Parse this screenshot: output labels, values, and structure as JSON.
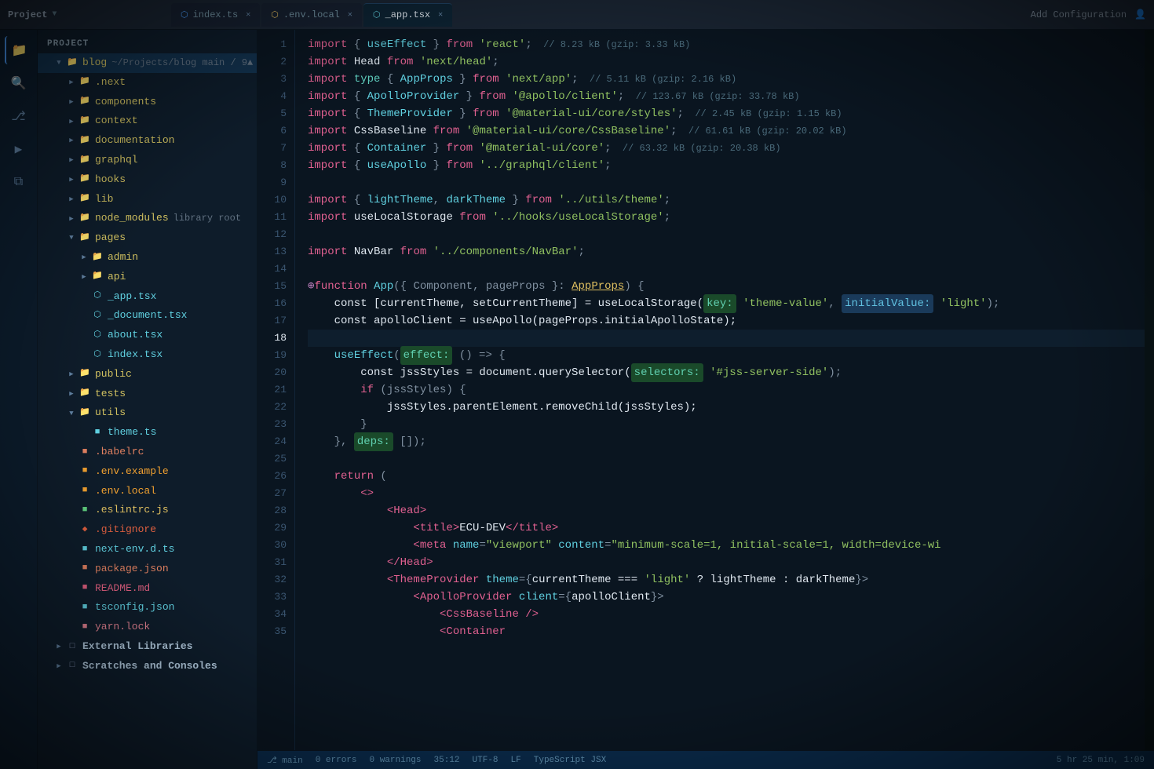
{
  "title_bar": {
    "project_label": "Project",
    "chevron": "▼",
    "tabs": [
      {
        "name": "index.ts",
        "icon": "⬡",
        "type": "ts",
        "active": false
      },
      {
        "name": ".env.local",
        "icon": "⬡",
        "type": "env",
        "active": false
      },
      {
        "name": "_app.tsx",
        "icon": "⬡",
        "type": "tsx",
        "active": true
      }
    ],
    "add_config": "Add Configuration",
    "run_button": "▶"
  },
  "sidebar": {
    "header": "Project",
    "tree": [
      {
        "id": "blog",
        "level": 1,
        "type": "folder-open",
        "label": "blog",
        "sublabel": "~/Projects/blog main / 9▲",
        "arrow": "▼"
      },
      {
        "id": "next",
        "level": 2,
        "type": "folder",
        "label": ".next",
        "arrow": "▶"
      },
      {
        "id": "components",
        "level": 2,
        "type": "folder",
        "label": "components",
        "arrow": "▶"
      },
      {
        "id": "context",
        "level": 2,
        "type": "folder",
        "label": "context",
        "arrow": "▶"
      },
      {
        "id": "documentation",
        "level": 2,
        "type": "folder",
        "label": "documentation",
        "arrow": "▶"
      },
      {
        "id": "graphql",
        "level": 2,
        "type": "folder",
        "label": "graphql",
        "arrow": "▶"
      },
      {
        "id": "hooks",
        "level": 2,
        "type": "folder",
        "label": "hooks",
        "arrow": "▶"
      },
      {
        "id": "lib",
        "level": 2,
        "type": "folder",
        "label": "lib",
        "arrow": "▶"
      },
      {
        "id": "node_modules",
        "level": 2,
        "type": "folder",
        "label": "node_modules",
        "sublabel": "library root",
        "arrow": "▶"
      },
      {
        "id": "pages",
        "level": 2,
        "type": "folder-open",
        "label": "pages",
        "arrow": "▼"
      },
      {
        "id": "admin",
        "level": 3,
        "type": "folder",
        "label": "admin",
        "arrow": "▶"
      },
      {
        "id": "api",
        "level": 3,
        "type": "folder",
        "label": "api",
        "arrow": "▶"
      },
      {
        "id": "_app_tsx",
        "level": 3,
        "type": "file-tsx",
        "label": "_app.tsx"
      },
      {
        "id": "_document_tsx",
        "level": 3,
        "type": "file-tsx",
        "label": "_document.tsx"
      },
      {
        "id": "about_tsx",
        "level": 3,
        "type": "file-tsx",
        "label": "about.tsx"
      },
      {
        "id": "index_tsx",
        "level": 3,
        "type": "file-tsx",
        "label": "index.tsx"
      },
      {
        "id": "public",
        "level": 2,
        "type": "folder",
        "label": "public",
        "arrow": "▶"
      },
      {
        "id": "tests",
        "level": 2,
        "type": "folder",
        "label": "tests",
        "arrow": "▶"
      },
      {
        "id": "utils",
        "level": 2,
        "type": "folder-open",
        "label": "utils",
        "arrow": "▼"
      },
      {
        "id": "theme_ts",
        "level": 3,
        "type": "file-ts",
        "label": "theme.ts"
      },
      {
        "id": "babelrc",
        "level": 2,
        "type": "file-json",
        "label": ".babelrc"
      },
      {
        "id": "env_example",
        "level": 2,
        "type": "file-env",
        "label": ".env.example"
      },
      {
        "id": "env_local",
        "level": 2,
        "type": "file-env",
        "label": ".env.local"
      },
      {
        "id": "eslintrc",
        "level": 2,
        "type": "file-js",
        "label": ".eslintrc.js"
      },
      {
        "id": "gitignore",
        "level": 2,
        "type": "file-git",
        "label": ".gitignore"
      },
      {
        "id": "next_env",
        "level": 2,
        "type": "file-ts",
        "label": "next-env.d.ts"
      },
      {
        "id": "package_json",
        "level": 2,
        "type": "file-json",
        "label": "package.json"
      },
      {
        "id": "readme",
        "level": 2,
        "type": "file-md",
        "label": "README.md"
      },
      {
        "id": "tsconfig",
        "level": 2,
        "type": "file-json",
        "label": "tsconfig.json"
      },
      {
        "id": "yarn_lock",
        "level": 2,
        "type": "file-lock",
        "label": "yarn.lock"
      },
      {
        "id": "external_libs",
        "level": 1,
        "type": "folder",
        "label": "External Libraries",
        "arrow": "▶"
      },
      {
        "id": "scratches",
        "level": 1,
        "type": "folder",
        "label": "Scratches and Consoles",
        "arrow": "▶"
      }
    ]
  },
  "code": {
    "filename": "_app.tsx",
    "lines": [
      {
        "n": 1,
        "content": "import { useEffect } from 'react'; // 8.23 kB (gzip: 3.33 kB)"
      },
      {
        "n": 2,
        "content": "import Head from 'next/head';"
      },
      {
        "n": 3,
        "content": "import type { AppProps } from 'next/app'; // 5.11 kB (gzip: 2.16 kB)"
      },
      {
        "n": 4,
        "content": "import { ApolloProvider } from '@apollo/client'; // 123.67 kB (gzip: 33.78 kB)"
      },
      {
        "n": 5,
        "content": "import { ThemeProvider } from '@material-ui/core/styles'; // 2.45 kB (gzip: 1.15 kB)"
      },
      {
        "n": 6,
        "content": "import CssBaseline from '@material-ui/core/CssBaseline'; // 61.61 kB (gzip: 20.02 kB)"
      },
      {
        "n": 7,
        "content": "import { Container } from '@material-ui/core'; // 63.32 kB (gzip: 20.38 kB)"
      },
      {
        "n": 8,
        "content": "import { useApollo } from '../graphql/client';"
      },
      {
        "n": 9,
        "content": ""
      },
      {
        "n": 10,
        "content": "import { lightTheme, darkTheme } from '../utils/theme';"
      },
      {
        "n": 11,
        "content": "import useLocalStorage from '../hooks/useLocalStorage';"
      },
      {
        "n": 12,
        "content": ""
      },
      {
        "n": 13,
        "content": "import NavBar from '../components/NavBar';"
      },
      {
        "n": 14,
        "content": ""
      },
      {
        "n": 15,
        "content": "function App({ Component, pageProps }: AppProps) {"
      },
      {
        "n": 16,
        "content": "  const [currentTheme, setCurrentTheme] = useLocalStorage( key: 'theme-value',  initialValue: 'light');"
      },
      {
        "n": 17,
        "content": "  const apolloClient = useApollo(pageProps.initialApolloState);"
      },
      {
        "n": 18,
        "content": ""
      },
      {
        "n": 19,
        "content": "  useEffect( effect: () => {"
      },
      {
        "n": 20,
        "content": "    const jssStyles = document.querySelector( selectors: '#jss-server-side');"
      },
      {
        "n": 21,
        "content": "    if (jssStyles) {"
      },
      {
        "n": 22,
        "content": "      jssStyles.parentElement.removeChild(jssStyles);"
      },
      {
        "n": 23,
        "content": "    }"
      },
      {
        "n": 24,
        "content": "  }, deps: []);"
      },
      {
        "n": 25,
        "content": ""
      },
      {
        "n": 26,
        "content": "  return ("
      },
      {
        "n": 27,
        "content": "    <>"
      },
      {
        "n": 28,
        "content": "      <Head>"
      },
      {
        "n": 29,
        "content": "        <title>ECU-DEV</title>"
      },
      {
        "n": 30,
        "content": "        <meta name=\"viewport\" content=\"minimum-scale=1, initial-scale=1, width=device-wi"
      },
      {
        "n": 31,
        "content": "      </Head>"
      },
      {
        "n": 32,
        "content": "      <ThemeProvider theme={currentTheme === 'light' ? lightTheme : darkTheme}>"
      },
      {
        "n": 33,
        "content": "        <ApolloProvider client={apolloClient}>"
      },
      {
        "n": 34,
        "content": "          <CssBaseline />"
      },
      {
        "n": 35,
        "content": "          <Container"
      }
    ]
  },
  "status_bar": {
    "branch": "main",
    "errors": "0 errors",
    "warnings": "0 warnings",
    "line_col": "35:12",
    "encoding": "UTF-8",
    "line_ending": "LF",
    "language": "TypeScript JSX",
    "time": "5 hr 25 min, 1:09"
  }
}
